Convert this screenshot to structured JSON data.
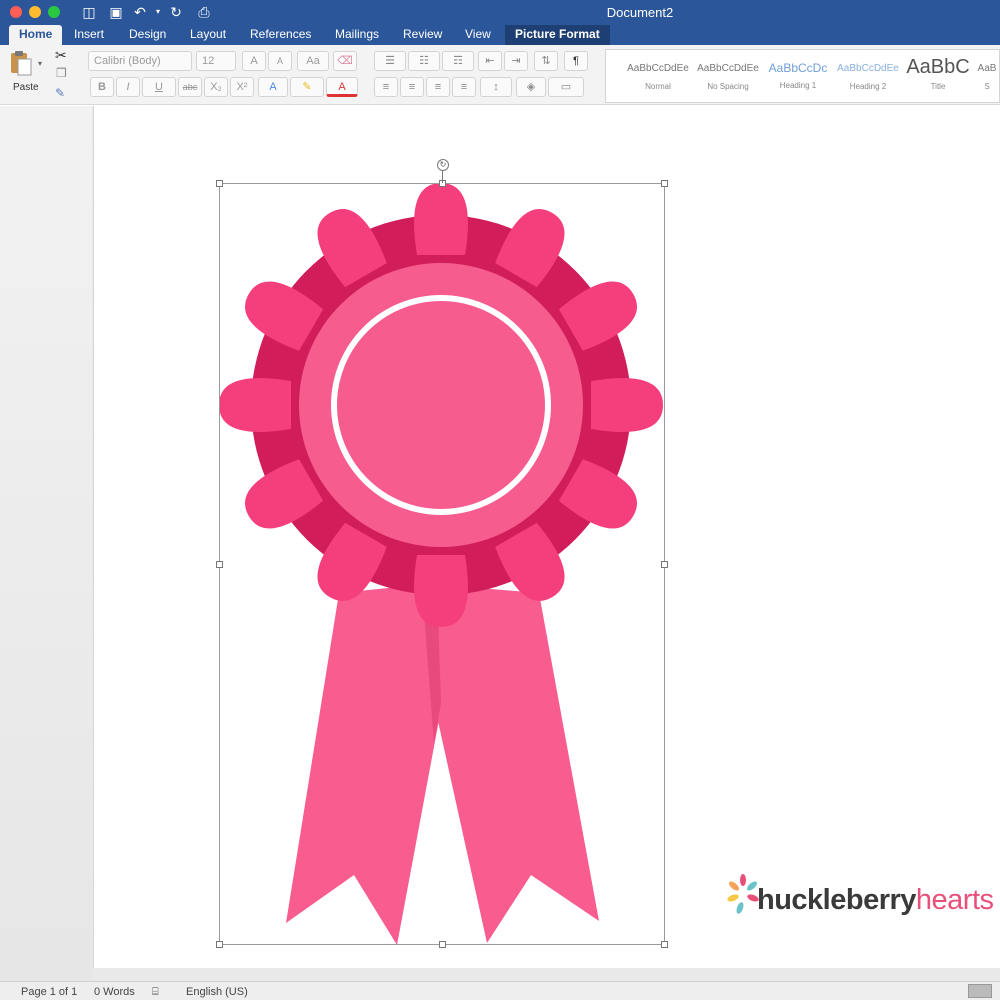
{
  "window": {
    "title": "Document2"
  },
  "tabs": [
    {
      "label": "Home",
      "active": true
    },
    {
      "label": "Insert"
    },
    {
      "label": "Design"
    },
    {
      "label": "Layout"
    },
    {
      "label": "References"
    },
    {
      "label": "Mailings"
    },
    {
      "label": "Review"
    },
    {
      "label": "View"
    },
    {
      "label": "Picture Format",
      "contextual": true
    }
  ],
  "ribbon": {
    "paste_label": "Paste",
    "font_name": "Calibri (Body)",
    "font_size": "12",
    "bold": "B",
    "italic": "I",
    "underline": "U",
    "strikethrough": "abc",
    "subscript": "X₂",
    "superscript": "X²",
    "grow_font": "A",
    "shrink_font": "A",
    "change_case": "Aa",
    "text_effects": "A",
    "font_color": "A",
    "pilcrow": "¶",
    "styles": [
      {
        "sample": "AaBbCcDdEe",
        "name": "Normal"
      },
      {
        "sample": "AaBbCcDdEe",
        "name": "No Spacing"
      },
      {
        "sample": "AaBbCcDc",
        "name": "Heading 1"
      },
      {
        "sample": "AaBbCcDdEe",
        "name": "Heading 2"
      },
      {
        "sample": "AaBbC",
        "name": "Title"
      },
      {
        "sample": "AaB",
        "name": "S"
      }
    ]
  },
  "document": {
    "image": "pink-award-rosette",
    "colors": {
      "petal": "#f53f7c",
      "petal_shadow": "#d11d5a",
      "ring": "#f75c8e",
      "center": "#f75c8e",
      "inner_ring": "#ffffff",
      "ribbon_tail": "#f95c8f"
    }
  },
  "watermark": {
    "part1": "huckleberry",
    "part2": "hearts"
  },
  "status": {
    "page": "Page 1 of 1",
    "words": "0 Words",
    "language": "English (US)"
  }
}
